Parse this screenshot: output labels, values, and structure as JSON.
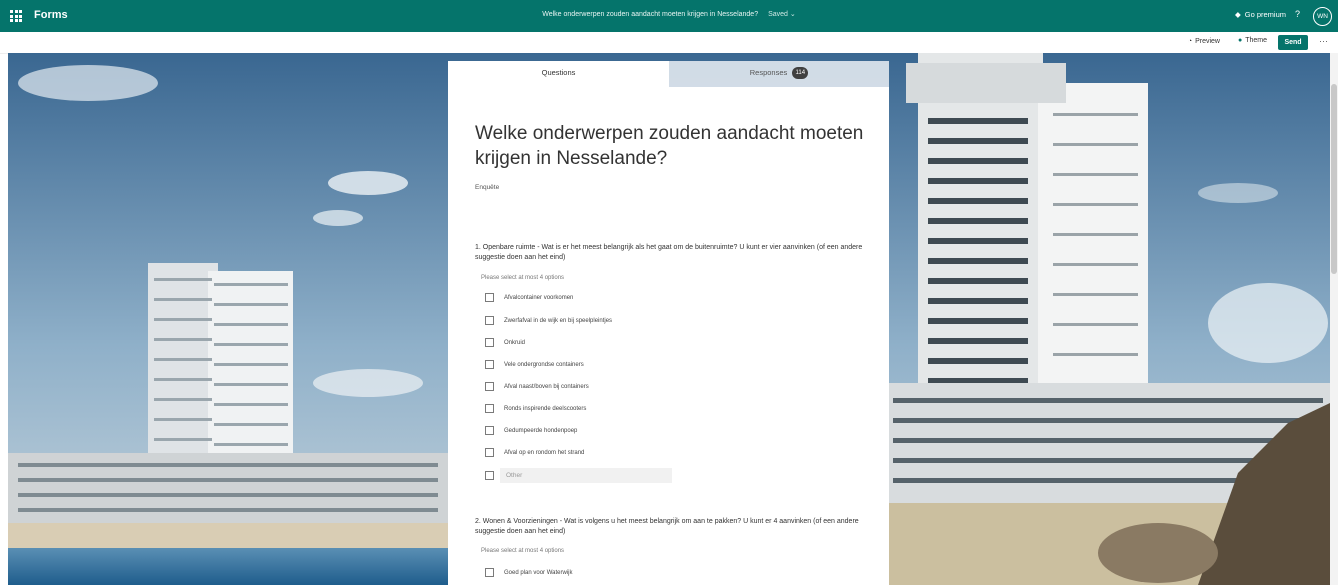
{
  "appbar": {
    "app_name": "Forms",
    "doc_title": "Welke onderwerpen zouden aandacht moeten krijgen in Nesselande?",
    "saved_label": "Saved ⌄",
    "premium_label": "Go premium",
    "help_label": "?",
    "avatar_initials": "WN"
  },
  "commandbar": {
    "preview_label": "Preview",
    "theme_label": "Theme",
    "send_label": "Send",
    "more_label": "···"
  },
  "tabs": {
    "questions_label": "Questions",
    "responses_label": "Responses",
    "responses_count": "114"
  },
  "form": {
    "title": "Welke onderwerpen zouden aandacht moeten krijgen in Nesselande?",
    "description": "Enquête",
    "questions": [
      {
        "text": "1. Openbare ruimte - Wat is er het meest belangrijk als het gaat om de buitenruimte? U kunt er vier aanvinken (of een andere suggestie doen aan het eind)",
        "hint": "Please select at most 4 options",
        "options": [
          "Afvalcontainer voorkomen",
          "Zwerfafval in de wijk en bij speelpleintjes",
          "Onkruid",
          "Vele ondergrondse containers",
          "Afval naast/boven bij containers",
          "Ronds inspirende deelscooters",
          "Gedumpeerde hondenpoep",
          "Afval op en rondom het strand"
        ],
        "other_placeholder": "Other"
      },
      {
        "text": "2. Wonen & Voorzieningen - Wat is volgens u het meest belangrijk om aan te pakken? U kunt er 4 aanvinken (of een andere suggestie doen aan het eind)",
        "hint": "Please select at most 4 options",
        "options": [
          "Goed plan voor Waterwijk"
        ]
      }
    ]
  },
  "colors": {
    "brand": "#05746b",
    "sky_top": "#3f6c9a",
    "sea": "#2e6fa0"
  }
}
